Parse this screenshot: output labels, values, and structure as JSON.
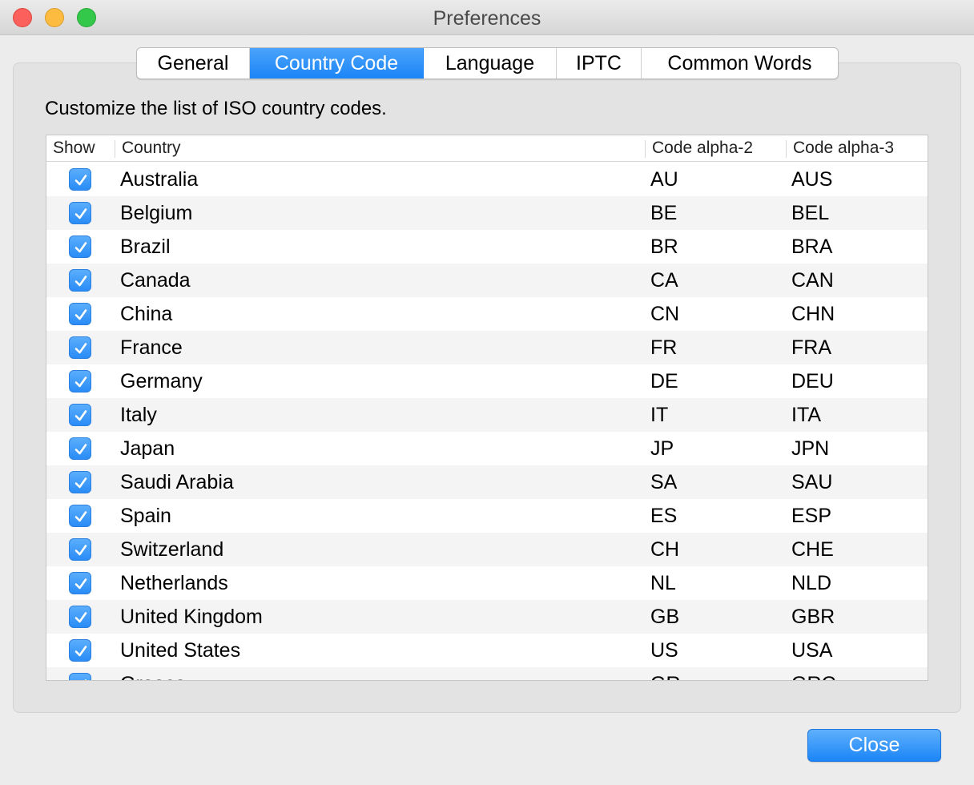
{
  "window": {
    "title": "Preferences"
  },
  "tabs": [
    {
      "label": "General",
      "active": false
    },
    {
      "label": "Country Code",
      "active": true
    },
    {
      "label": "Language",
      "active": false
    },
    {
      "label": "IPTC",
      "active": false
    },
    {
      "label": "Common Words",
      "active": false
    }
  ],
  "description": "Customize the list of ISO country codes.",
  "table": {
    "columns": {
      "show": "Show",
      "country": "Country",
      "alpha2": "Code alpha-2",
      "alpha3": "Code alpha-3"
    },
    "rows": [
      {
        "show": true,
        "country": "Australia",
        "alpha2": "AU",
        "alpha3": "AUS"
      },
      {
        "show": true,
        "country": "Belgium",
        "alpha2": "BE",
        "alpha3": "BEL"
      },
      {
        "show": true,
        "country": "Brazil",
        "alpha2": "BR",
        "alpha3": "BRA"
      },
      {
        "show": true,
        "country": "Canada",
        "alpha2": "CA",
        "alpha3": "CAN"
      },
      {
        "show": true,
        "country": "China",
        "alpha2": "CN",
        "alpha3": "CHN"
      },
      {
        "show": true,
        "country": "France",
        "alpha2": "FR",
        "alpha3": "FRA"
      },
      {
        "show": true,
        "country": "Germany",
        "alpha2": "DE",
        "alpha3": "DEU"
      },
      {
        "show": true,
        "country": "Italy",
        "alpha2": "IT",
        "alpha3": "ITA"
      },
      {
        "show": true,
        "country": "Japan",
        "alpha2": "JP",
        "alpha3": "JPN"
      },
      {
        "show": true,
        "country": "Saudi Arabia",
        "alpha2": "SA",
        "alpha3": "SAU"
      },
      {
        "show": true,
        "country": "Spain",
        "alpha2": "ES",
        "alpha3": "ESP"
      },
      {
        "show": true,
        "country": "Switzerland",
        "alpha2": "CH",
        "alpha3": "CHE"
      },
      {
        "show": true,
        "country": "Netherlands",
        "alpha2": "NL",
        "alpha3": "NLD"
      },
      {
        "show": true,
        "country": "United Kingdom",
        "alpha2": "GB",
        "alpha3": "GBR"
      },
      {
        "show": true,
        "country": "United States",
        "alpha2": "US",
        "alpha3": "USA"
      },
      {
        "show": true,
        "country": "Greece",
        "alpha2": "GR",
        "alpha3": "GRC"
      }
    ]
  },
  "buttons": {
    "close": "Close"
  },
  "colors": {
    "accent": "#1b85f7",
    "close_light": "#fc605c",
    "minimize_light": "#fdbc40",
    "zoom_light": "#34c84a"
  }
}
